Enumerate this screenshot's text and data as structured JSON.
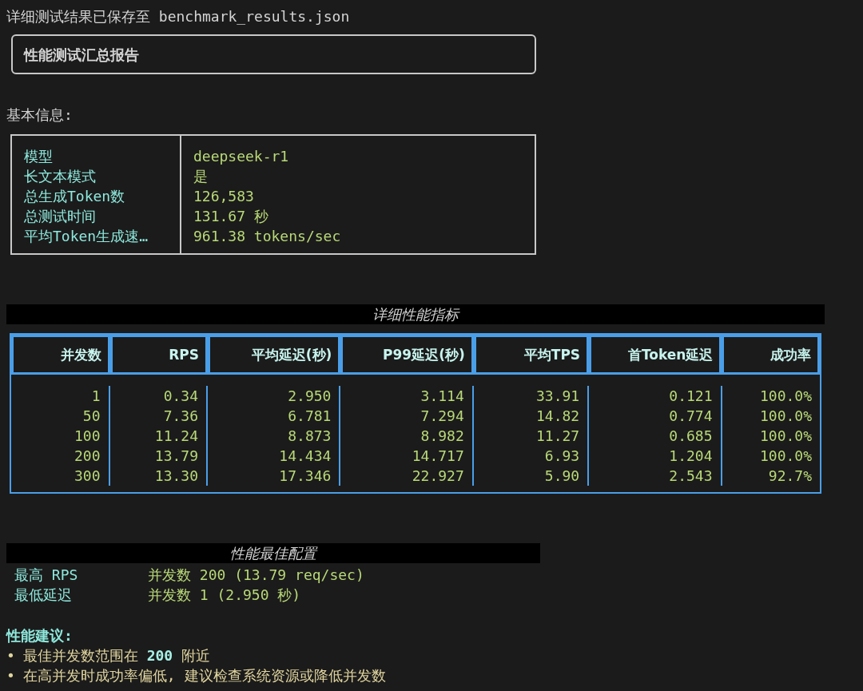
{
  "log_line": "详细测试结果已保存至 benchmark_results.json",
  "summary_panel": {
    "title": "性能测试汇总报告"
  },
  "basic_info": {
    "heading": "基本信息:",
    "rows": [
      {
        "label": "模型",
        "value": "deepseek-r1"
      },
      {
        "label": "长文本模式",
        "value": "是"
      },
      {
        "label": "总生成Token数",
        "value": "126,583"
      },
      {
        "label": "总测试时间",
        "value": "131.67 秒"
      },
      {
        "label": "平均Token生成速…",
        "value": "961.38 tokens/sec"
      }
    ]
  },
  "metrics_table": {
    "title": "详细性能指标",
    "columns": [
      "并发数",
      "RPS",
      "平均延迟(秒)",
      "P99延迟(秒)",
      "平均TPS",
      "首Token延迟",
      "成功率"
    ],
    "rows": [
      [
        "1",
        "0.34",
        "2.950",
        "3.114",
        "33.91",
        "0.121",
        "100.0%"
      ],
      [
        "50",
        "7.36",
        "6.781",
        "7.294",
        "14.82",
        "0.774",
        "100.0%"
      ],
      [
        "100",
        "11.24",
        "8.873",
        "8.982",
        "11.27",
        "0.685",
        "100.0%"
      ],
      [
        "200",
        "13.79",
        "14.434",
        "14.717",
        "6.93",
        "1.204",
        "100.0%"
      ],
      [
        "300",
        "13.30",
        "17.346",
        "22.927",
        "5.90",
        "2.543",
        "92.7%"
      ]
    ]
  },
  "best_config": {
    "title": "性能最佳配置",
    "rows": [
      {
        "label": "最高 RPS",
        "value": "并发数 200 (13.79 req/sec)"
      },
      {
        "label": "最低延迟",
        "value": "并发数 1 (2.950 秒)"
      }
    ]
  },
  "suggestions": {
    "heading": "性能建议:",
    "items": [
      {
        "bullet": "•",
        "text": "最佳并发数范围在 **200** 附近"
      },
      {
        "bullet": "•",
        "text": "在高并发时成功率偏低, 建议检查系统资源或降低并发数"
      }
    ]
  }
}
